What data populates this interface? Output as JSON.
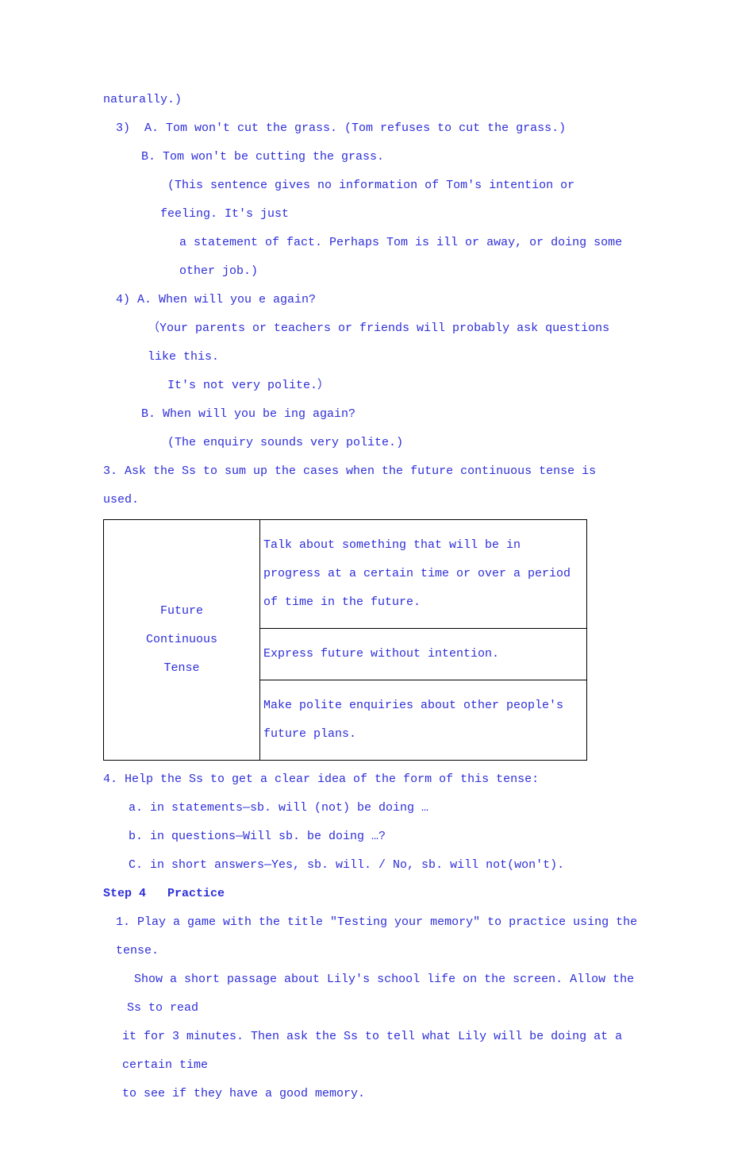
{
  "l1": "naturally.)",
  "l2": "3)  A. Tom won't cut the grass. (Tom refuses to cut the grass.)",
  "l3": "B. Tom won't be cutting the grass.",
  "l4": " (This sentence gives no information of Tom's intention or feeling. It's just",
  "l5": "a statement of fact. Perhaps Tom is ill or away, or doing some other job.)",
  "l6": "4) A. When will you e again?",
  "l7": "（Your parents or teachers or friends will probably ask questions like this.",
  "l8": " It's not very polite.）",
  "l9": "B. When will you be ing again?",
  "l10": " (The enquiry sounds very polite.)",
  "l11": "3. Ask the Ss to sum up the cases when the future continuous tense is used.",
  "table": {
    "left1": "Future",
    "left2": "Continuous",
    "left3": "Tense",
    "r1": "Talk about something that will be in progress at a certain time or over a period of time in the future.",
    "r2": "Express future without intention.",
    "r3": "Make polite enquiries about other people's future plans."
  },
  "l12": "4. Help the Ss to get a clear idea of the form of this tense:",
  "l13": "a. in statements—sb. will (not) be doing …",
  "l14": "b. in questions—Will sb. be doing …?",
  "l15": "C. in short answers—Yes, sb. will. / No, sb. will not(won't).",
  "step4": "Step 4   Practice",
  "p1": "1. Play a game with the title \"Testing your memory\" to practice using the tense.",
  "p2": " Show a short passage about Lily's school life on the screen. Allow the Ss to read",
  "p3": "it for 3 minutes. Then ask the Ss to tell what Lily will be doing at a certain time",
  "p4": "to see if they have a good memory."
}
